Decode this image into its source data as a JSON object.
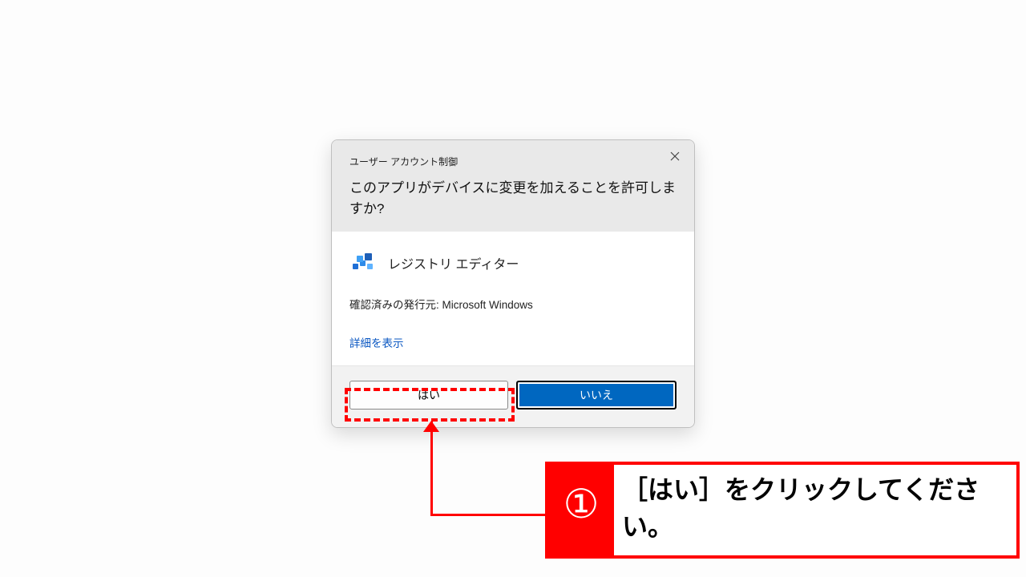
{
  "dialog": {
    "title": "ユーザー アカウント制御",
    "question": "このアプリがデバイスに変更を加えることを許可しますか?",
    "app_name": "レジストリ エディター",
    "publisher_line": "確認済みの発行元: Microsoft Windows",
    "details_link": "詳細を表示",
    "yes_label": "はい",
    "no_label": "いいえ"
  },
  "annotation": {
    "step_number": "①",
    "instruction": "［はい］をクリックしてください。"
  }
}
